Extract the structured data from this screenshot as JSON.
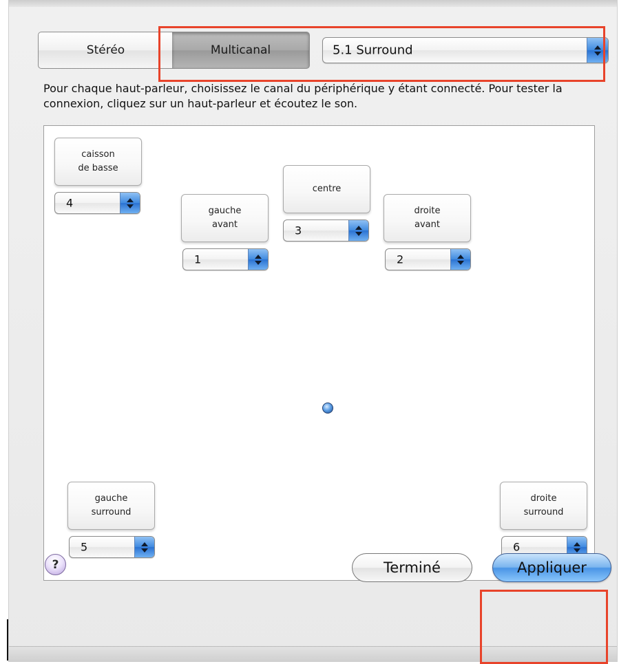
{
  "segmented": {
    "stereo_label": "Stéréo",
    "multichannel_label": "Multicanal",
    "selected": "Multicanal"
  },
  "mode_popup": {
    "value": "5.1 Surround"
  },
  "instructions": "Pour chaque haut-parleur, choisissez le canal du périphérique y étant connecté. Pour tester la connexion, cliquez sur un haut-parleur et écoutez le son.",
  "speakers": {
    "subwoofer": {
      "line1": "caisson",
      "line2": "de basse",
      "channel": "4"
    },
    "front_left": {
      "line1": "gauche",
      "line2": "avant",
      "channel": "1"
    },
    "center": {
      "line1": "centre",
      "channel": "3"
    },
    "front_right": {
      "line1": "droite",
      "line2": "avant",
      "channel": "2"
    },
    "surround_left": {
      "line1": "gauche",
      "line2": "surround",
      "channel": "5"
    },
    "surround_right": {
      "line1": "droite",
      "line2": "surround",
      "channel": "6"
    }
  },
  "help": {
    "symbol": "?"
  },
  "buttons": {
    "done_label": "Terminé",
    "apply_label": "Appliquer"
  },
  "colors": {
    "highlight": "#e8432a",
    "popup_arrow_blue": "#3f8ae0",
    "default_button": "#4a95e6",
    "help_purple": "#b9a2de"
  }
}
